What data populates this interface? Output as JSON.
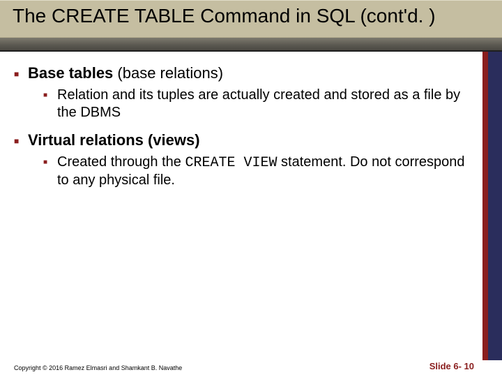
{
  "title": "The CREATE TABLE Command in SQL (cont'd. )",
  "items": [
    {
      "heading_prefix": "Base tables ",
      "heading_paren": "(base relations)",
      "sub": [
        {
          "text": "Relation and its tuples are actually created and stored as a file by the DBMS"
        }
      ]
    },
    {
      "heading_prefix": "Virtual relations (views)",
      "heading_paren": "",
      "sub": [
        {
          "pre": "Created through the ",
          "code": "CREATE VIEW",
          "post": " statement. Do not correspond to any physical file."
        }
      ]
    }
  ],
  "footer": {
    "copyright": "Copyright © 2016 Ramez Elmasri and Shamkant B. Navathe",
    "slidenum": "Slide 6- 10"
  }
}
